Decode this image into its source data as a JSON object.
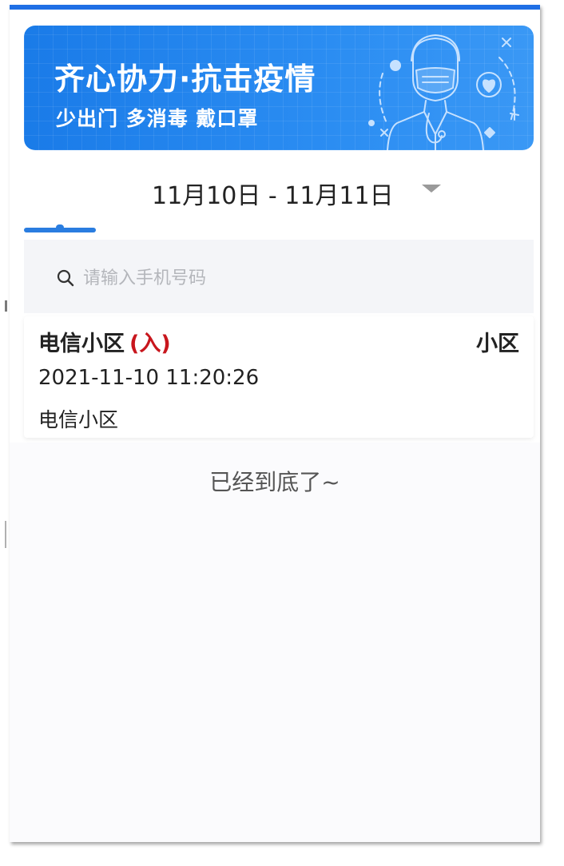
{
  "banner": {
    "title": "齐心协力·抗击疫情",
    "subtitle": "少出门 多消毒 戴口罩",
    "illustration": "doctor-with-mask-icon"
  },
  "filter": {
    "date_range": "11月10日 - 11月11日",
    "dropdown_icon": "caret-down-icon"
  },
  "search": {
    "placeholder": "请输入手机号码",
    "value": "",
    "icon": "search-icon"
  },
  "records": [
    {
      "name": "电信小区",
      "direction": "(入)",
      "type": "小区",
      "time": "2021-11-10 11:20:26",
      "location": "电信小区"
    }
  ],
  "list_end_text": "已经到底了~",
  "colors": {
    "accent": "#2a7de0",
    "banner": "#1a7be8",
    "direction_in": "#c8161d"
  }
}
